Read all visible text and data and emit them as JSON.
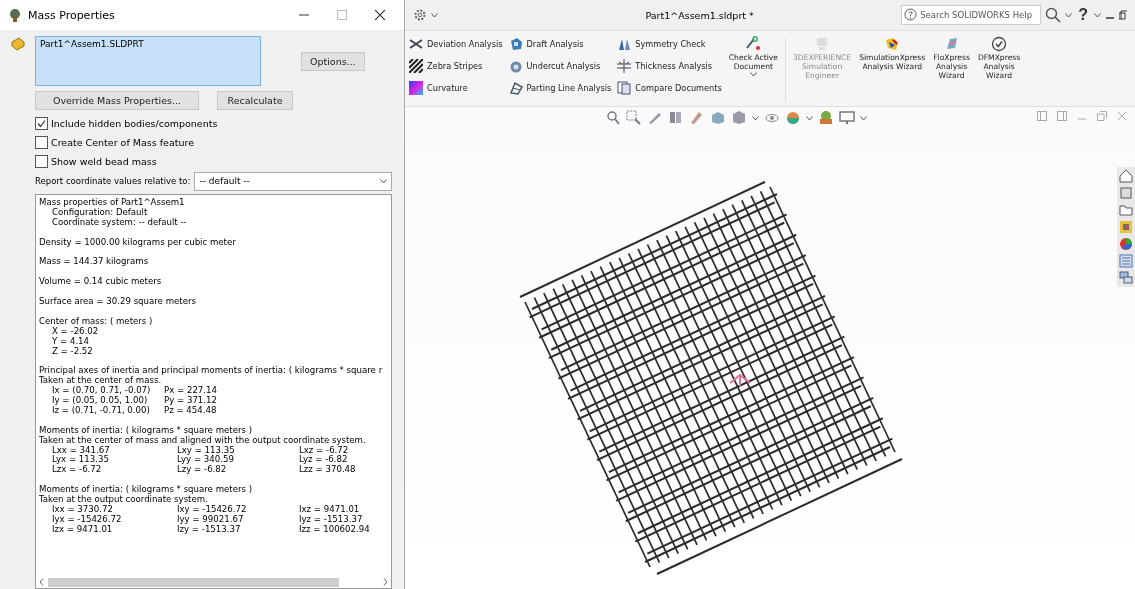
{
  "dialog": {
    "title": "Mass Properties",
    "selection": [
      "Part1^Assem1.SLDPRT"
    ],
    "options_button": "Options...",
    "override_button": "Override Mass Properties...",
    "recalculate_button": "Recalculate",
    "checkboxes": [
      {
        "label": "Include hidden bodies/components",
        "checked": true
      },
      {
        "label": "Create Center of Mass feature",
        "checked": false
      },
      {
        "label": "Show weld bead mass",
        "checked": false
      }
    ],
    "report_label": "Report coordinate values relative to:",
    "report_select": "-- default --",
    "output": [
      {
        "lines": [
          "Mass properties of Part1^Assem1"
        ],
        "children": [
          "Configuration: Default",
          "Coordinate system: -- default --"
        ]
      },
      {
        "lines": [
          "Density = 1000.00 kilograms per cubic meter"
        ]
      },
      {
        "lines": [
          "Mass = 144.37 kilograms"
        ]
      },
      {
        "lines": [
          "Volume = 0.14 cubic meters"
        ]
      },
      {
        "lines": [
          "Surface area = 30.29 square meters"
        ]
      },
      {
        "lines": [
          "Center of mass: ( meters )"
        ],
        "children": [
          "X = -26.02",
          "Y = 4.14",
          "Z = -2.52"
        ]
      },
      {
        "lines": [
          "Principal axes of inertia and principal moments of inertia: ( kilograms * square r",
          "Taken at the center of mass."
        ],
        "table": [
          [
            "Ix = (0.70,  0.71, -0.07)",
            "Px = 227.14"
          ],
          [
            "Iy = (0.05,  0.05,  1.00)",
            "Py = 371.12"
          ],
          [
            "Iz = (0.71, -0.71,  0.00)",
            "Pz = 454.48"
          ]
        ]
      },
      {
        "lines": [
          "Moments of inertia: ( kilograms * square meters )",
          "Taken at the center of mass and aligned with the output coordinate system."
        ],
        "table": [
          [
            "Lxx = 341.67",
            "Lxy = 113.35",
            "Lxz = -6.72"
          ],
          [
            "Lyx = 113.35",
            "Lyy = 340.59",
            "Lyz = -6.82"
          ],
          [
            "Lzx = -6.72",
            "Lzy = -6.82",
            "Lzz = 370.48"
          ]
        ]
      },
      {
        "lines": [
          "Moments of inertia: ( kilograms * square meters )",
          "Taken at the output coordinate system."
        ],
        "table": [
          [
            "Ixx = 3730.72",
            "Ixy = -15426.72",
            "Ixz = 9471.01"
          ],
          [
            "Iyx = -15426.72",
            "Iyy = 99021.67",
            "Iyz = -1513.37"
          ],
          [
            "Izx = 9471.01",
            "Izy = -1513.37",
            "Izz = 100602.94"
          ]
        ]
      }
    ]
  },
  "app": {
    "title": "Part1^Assem1.sldprt *",
    "search_placeholder": "Search SOLIDWORKS Help",
    "help_button": "?",
    "ribbon_columns": [
      {
        "items": [
          "Deviation Analysis",
          "Zebra Stripes",
          "Curvature"
        ]
      },
      {
        "items": [
          "Draft Analysis",
          "Undercut Analysis",
          "Parting Line Analysis"
        ]
      },
      {
        "items": [
          "Symmetry Check",
          "Thickness Analysis",
          "Compare Documents"
        ]
      }
    ],
    "ribbon_large": [
      {
        "label": "Check Active\nDocument",
        "disabled": false,
        "has_menu": true
      },
      {
        "label": "3DEXPERIENCE\nSimulation\nEngineer",
        "disabled": true,
        "has_menu": false
      },
      {
        "label": "SimulationXpress\nAnalysis Wizard",
        "disabled": false,
        "has_menu": false
      },
      {
        "label": "FloXpress\nAnalysis\nWizard",
        "disabled": false,
        "has_menu": false
      },
      {
        "label": "DFMXpress\nAnalysis\nWizard",
        "disabled": false,
        "has_menu": false
      }
    ]
  }
}
